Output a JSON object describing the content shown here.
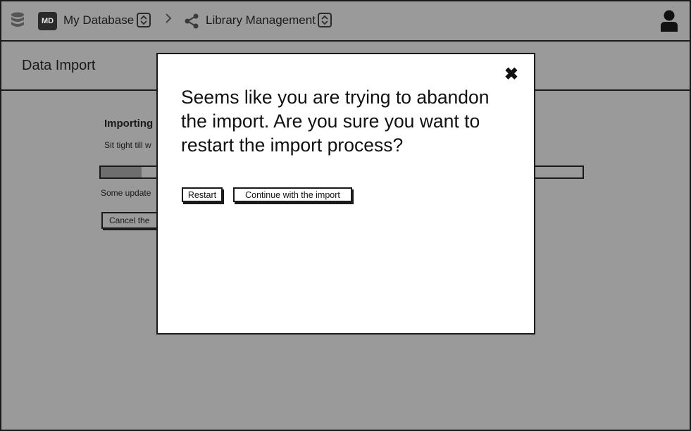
{
  "topbar": {
    "db_badge": "MD",
    "db_name": "My Database",
    "project_name": "Library Management"
  },
  "page": {
    "title": "Data Import"
  },
  "background": {
    "heading": "Importing",
    "subtext": "Sit tight till w",
    "progress_fraction": 0.085,
    "note": "Some update",
    "cancel_label": "Cancel the"
  },
  "modal": {
    "close_glyph": "✖",
    "message": "Seems like you are trying to abandon the import. Are you sure you want to restart the import process?",
    "restart_label": "Restart",
    "continue_label": "Continue with the import"
  },
  "colors": {
    "overlay": "#9a9a9a",
    "ink": "#1a1a1a",
    "modal_bg": "#ffffff"
  }
}
